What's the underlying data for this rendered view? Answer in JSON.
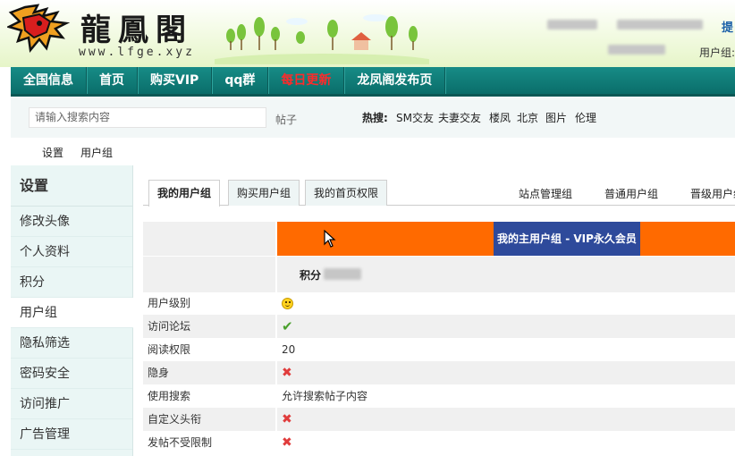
{
  "header": {
    "logo_title": "龍鳳閣",
    "logo_url": "www.lfge.xyz",
    "right_link": "提",
    "user_group_label": "用户组:"
  },
  "nav": {
    "items": [
      {
        "label": "全国信息"
      },
      {
        "label": "首页"
      },
      {
        "label": "购买VIP"
      },
      {
        "label": "qq群"
      },
      {
        "label": "每日更新",
        "highlight_color": "#ff2a2a"
      },
      {
        "label": "龙凤阁发布页"
      }
    ]
  },
  "search": {
    "placeholder": "请输入搜索内容",
    "type": "帖子",
    "hot_label": "热搜:",
    "hot_words": [
      "SM交友",
      "夫妻交友",
      "楼凤",
      "北京",
      "图片",
      "伦理"
    ]
  },
  "breadcrumb": [
    "设置",
    "用户组"
  ],
  "sidebar": {
    "title": "设置",
    "items": [
      {
        "label": "修改头像"
      },
      {
        "label": "个人资料"
      },
      {
        "label": "积分"
      },
      {
        "label": "用户组",
        "active": true
      },
      {
        "label": "隐私筛选"
      },
      {
        "label": "密码安全"
      },
      {
        "label": "访问推广"
      },
      {
        "label": "广告管理"
      }
    ]
  },
  "tabs": [
    {
      "label": "我的用户组",
      "active": true
    },
    {
      "label": "购买用户组"
    },
    {
      "label": "我的首页权限"
    }
  ],
  "right_tabs": [
    "站点管理组",
    "普通用户组",
    "晋级用户组"
  ],
  "group": {
    "main_group": "我的主用户组 - VIP永久会员",
    "score_label": "积分",
    "accent": "#ff6a00",
    "group_bg": "#2e4a9b"
  },
  "permissions": [
    {
      "label": "用户级别",
      "value": "",
      "icon": "smile-icon"
    },
    {
      "label": "访问论坛",
      "value": "",
      "icon": "check-icon"
    },
    {
      "label": "阅读权限",
      "value": "20",
      "icon": ""
    },
    {
      "label": "隐身",
      "value": "",
      "icon": "cross-icon"
    },
    {
      "label": "使用搜索",
      "value": "允许搜索帖子内容",
      "icon": ""
    },
    {
      "label": "自定义头衔",
      "value": "",
      "icon": "cross-icon"
    },
    {
      "label": "发帖不受限制",
      "value": "",
      "icon": "cross-icon"
    }
  ],
  "icons": {
    "check": "✔",
    "cross": "✖"
  }
}
